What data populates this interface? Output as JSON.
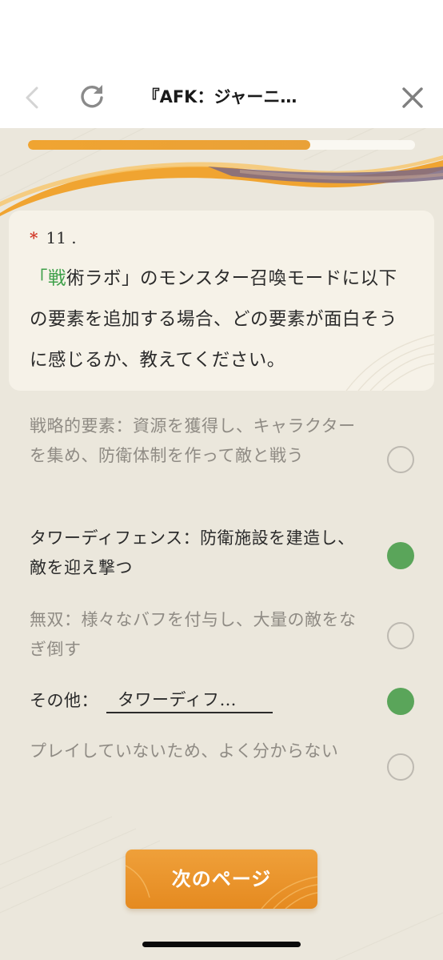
{
  "header": {
    "title": "『AFK：ジャーニ…",
    "back_icon": "chevron-left-icon",
    "reload_icon": "reload-icon",
    "close_icon": "close-icon"
  },
  "progress": {
    "fraction": 0.73
  },
  "question": {
    "required_mark": "*",
    "number": "11 .",
    "text_highlight": "「戦",
    "text_rest": "術ラボ」のモンスター召喚モードに以下の要素を追加する場合、どの要素が面白そうに感じるか、教えてください。"
  },
  "options": [
    {
      "label": "戦略的要素：資源を獲得し、キャラクターを集め、防衛体制を作って敵と戦う",
      "selected": false
    },
    {
      "label": "タワーディフェンス：防衛施設を建造し、敵を迎え撃つ",
      "selected": true
    },
    {
      "label": "無双：様々なバフを付与し、大量の敵をなぎ倒す",
      "selected": false
    },
    {
      "label": "その他：",
      "input_value": "タワーディフ…",
      "selected": true
    },
    {
      "label": "プレイしていないため、よく分からない",
      "selected": false
    }
  ],
  "next_button": {
    "label": "次のページ"
  },
  "colors": {
    "accent_orange": "#f0a431",
    "selected_green": "#5aa55a",
    "required_red": "#d23b2a",
    "highlight_green": "#3fa04a",
    "background": "#ebe7dc"
  }
}
